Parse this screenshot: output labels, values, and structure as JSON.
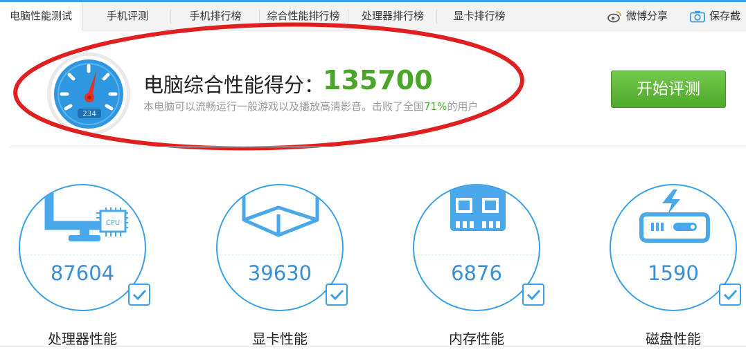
{
  "tabs": [
    {
      "label": "电脑性能测试",
      "active": true
    },
    {
      "label": "手机评测"
    },
    {
      "label": "手机排行榜"
    },
    {
      "label": "综合性能排行榜"
    },
    {
      "label": "处理器排行榜"
    },
    {
      "label": "显卡排行榜"
    }
  ],
  "share": {
    "weibo_label": "微博分享",
    "save_label": "保存截"
  },
  "score": {
    "label": "电脑综合性能得分：",
    "value": "135700",
    "desc_prefix": "本电脑可以流畅运行一般游戏以及播放高清影音。击败了全国",
    "desc_percent": "71%",
    "desc_suffix": "的用户",
    "gauge_reading": "234"
  },
  "start_button": "开始评测",
  "metrics": [
    {
      "name": "cpu",
      "value": "87604",
      "label": "处理器性能",
      "chip_text": "CPU",
      "checked": true
    },
    {
      "name": "gpu",
      "value": "39630",
      "label": "显卡性能",
      "checked": true
    },
    {
      "name": "memory",
      "value": "6876",
      "label": "内存性能",
      "checked": true
    },
    {
      "name": "disk",
      "value": "1590",
      "label": "磁盘性能",
      "checked": true
    }
  ],
  "icons": [
    "weibo-icon",
    "camera-icon",
    "gauge-icon",
    "monitor-cpu-icon",
    "cube-icon",
    "memory-chip-icon",
    "hard-disk-icon",
    "checkbox-checked-icon"
  ],
  "colors": {
    "accent_blue": "#3aa0e6",
    "score_green": "#4aa52a",
    "button_green": "#5cb736",
    "annotation_red": "#e02020",
    "needle_red": "#e53224"
  }
}
